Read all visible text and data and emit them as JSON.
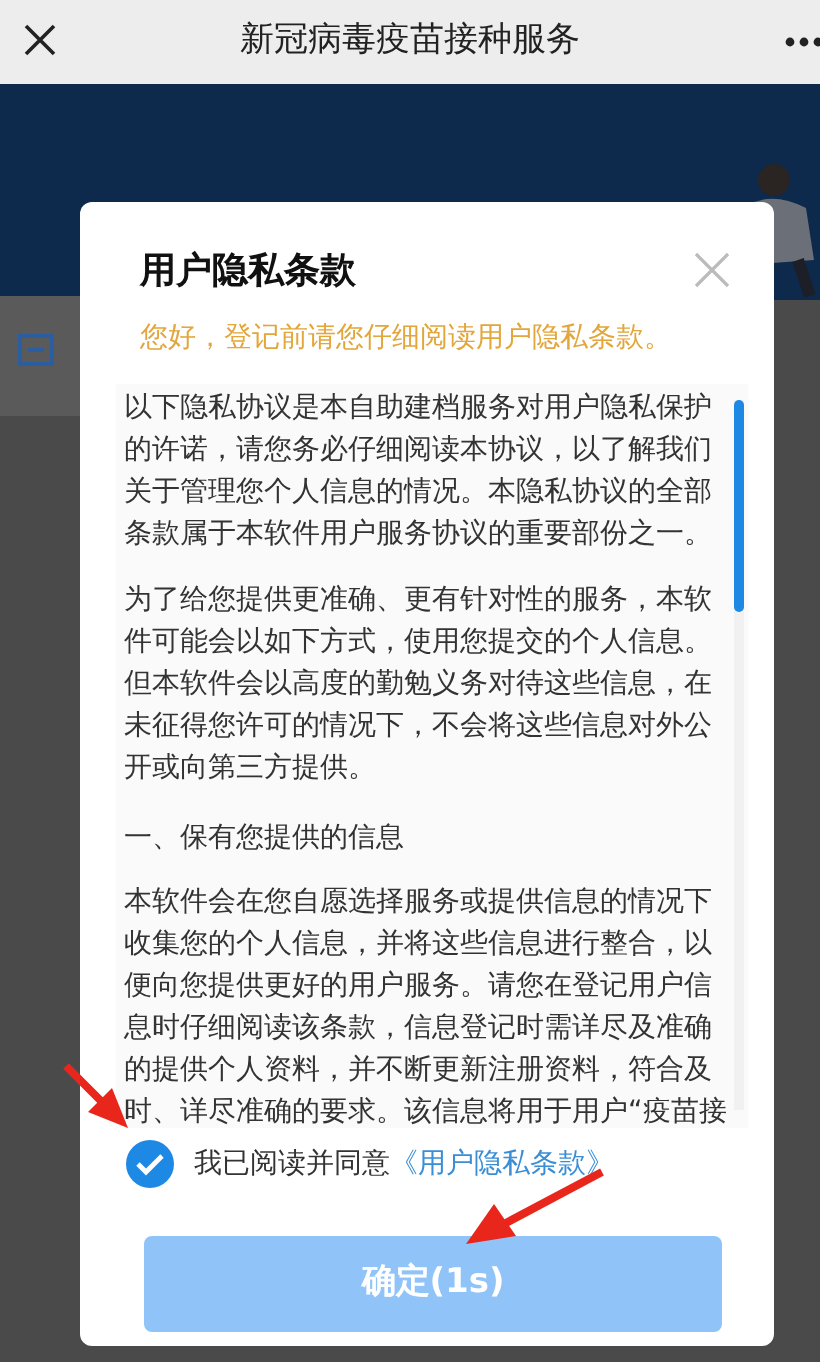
{
  "nav": {
    "title": "新冠病毒疫苗接种服务"
  },
  "dialog": {
    "title": "用户隐私条款",
    "subtitle": "您好，登记前请您仔细阅读用户隐私条款。",
    "paragraphs": [
      {
        "kind": "text",
        "text": "以下隐私协议是本自助建档服务对用户隐私保护的许诺，请您务必仔细阅读本协议，以了解我们关于管理您个人信息的情况。本隐私协议的全部条款属于本软件用户服务协议的重要部份之一。"
      },
      {
        "kind": "text",
        "text": "为了给您提供更准确、更有针对性的服务，本软件可能会以如下方式，使用您提交的个人信息。但本软件会以高度的勤勉义务对待这些信息，在未征得您许可的情况下，不会将这些信息对外公开或向第三方提供。"
      },
      {
        "kind": "heading",
        "text": "一、保有您提供的信息"
      },
      {
        "kind": "text",
        "text": "本软件会在您自愿选择服务或提供信息的情况下收集您的个人信息，并将这些信息进行整合，以便向您提供更好的用户服务。请您在登记用户信息时仔细阅读该条款，信息登记时需详尽及准确的提供个人资料，并不断更新注册资料，符合及时、详尽准确的要求。该信息将用于用户“疫苗接"
      }
    ],
    "agree": {
      "checked": true,
      "label": "我已阅读并同意",
      "link": "《用户隐私条款》"
    },
    "confirm": {
      "label": "确定(1s)",
      "disabled": true
    }
  }
}
